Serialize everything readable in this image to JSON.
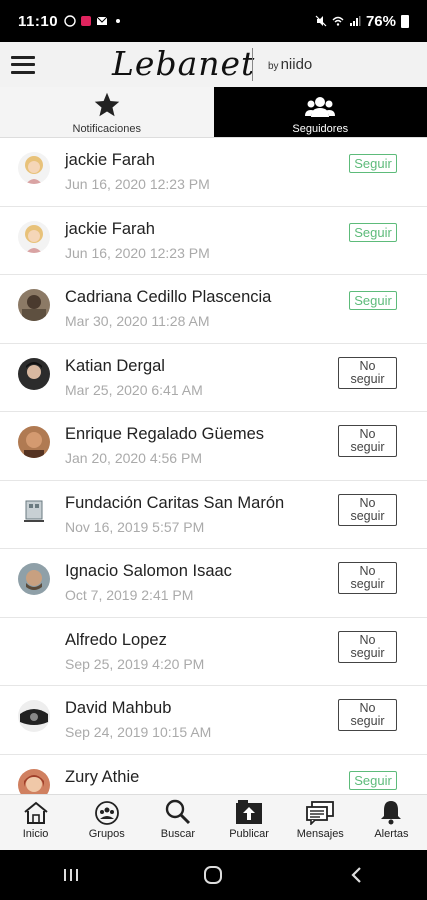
{
  "status_bar": {
    "time": "11:10",
    "battery": "76%"
  },
  "app_header": {
    "brand": "Lebanet",
    "by": "by",
    "partner": "niido"
  },
  "tabs": [
    {
      "label": "Notificaciones",
      "icon": "star-icon",
      "active": false
    },
    {
      "label": "Seguidores",
      "icon": "people-icon",
      "active": true
    }
  ],
  "followers": [
    {
      "name": "jackie Farah",
      "date": "Jun 16, 2020 12:23 PM",
      "action": "Seguir",
      "avatar_color": "#e8c27a"
    },
    {
      "name": "jackie Farah",
      "date": "Jun 16, 2020 12:23 PM",
      "action": "Seguir",
      "avatar_color": "#e8c27a"
    },
    {
      "name": "Cadriana Cedillo Plascencia",
      "date": "Mar 30, 2020 11:28 AM",
      "action": "Seguir",
      "avatar_color": "#6b5a48"
    },
    {
      "name": "Katian Dergal",
      "date": "Mar 25, 2020 6:41 AM",
      "action_line1": "No",
      "action_line2": "seguir",
      "avatar_color": "#3a3a3a"
    },
    {
      "name": "Enrique Regalado Güemes",
      "date": "Jan 20, 2020 4:56 PM",
      "action_line1": "No",
      "action_line2": "seguir",
      "avatar_color": "#a0704e"
    },
    {
      "name": "Fundación Caritas San Marón",
      "date": "Nov 16, 2019 5:57 PM",
      "action_line1": "No",
      "action_line2": "seguir",
      "avatar_color": "#8aa0a8"
    },
    {
      "name": "Ignacio Salomon Isaac",
      "date": "Oct 7, 2019 2:41 PM",
      "action_line1": "No",
      "action_line2": "seguir",
      "avatar_color": "#7a6a5a"
    },
    {
      "name": "Alfredo Lopez",
      "date": "Sep 25, 2019 4:20 PM",
      "action_line1": "No",
      "action_line2": "seguir",
      "avatar_color": "#ffffff"
    },
    {
      "name": "David Mahbub",
      "date": "Sep 24, 2019 10:15 AM",
      "action_line1": "No",
      "action_line2": "seguir",
      "avatar_color": "#555555"
    },
    {
      "name": "Zury Athie",
      "date": "",
      "action": "Seguir",
      "avatar_color": "#c0603a"
    }
  ],
  "bottom_nav": [
    {
      "label": "Inicio",
      "icon": "home-icon"
    },
    {
      "label": "Grupos",
      "icon": "groups-icon"
    },
    {
      "label": "Buscar",
      "icon": "search-icon"
    },
    {
      "label": "Publicar",
      "icon": "publish-icon"
    },
    {
      "label": "Mensajes",
      "icon": "messages-icon"
    },
    {
      "label": "Alertas",
      "icon": "bell-icon"
    }
  ],
  "colors": {
    "follow_green": "#5dbb7a",
    "active_tab": "#000000"
  }
}
